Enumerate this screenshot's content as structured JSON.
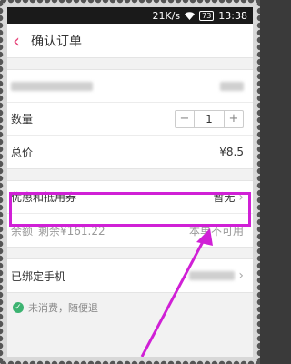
{
  "statusbar": {
    "speed": "21K/s",
    "battery": "73",
    "time": "13:38"
  },
  "header": {
    "back_icon": "chevron-left-icon",
    "title": "确认订单"
  },
  "order": {
    "quantity_label": "数量",
    "quantity_value": "1",
    "minus": "−",
    "plus": "+",
    "total_label": "总价",
    "total_value": "¥8.5"
  },
  "discount": {
    "coupon_label": "优惠和抵用券",
    "coupon_value": "暂无",
    "balance_label": "余额",
    "balance_remaining": "剩余¥161.22",
    "balance_status": "本单不可用"
  },
  "phone": {
    "label": "已绑定手机"
  },
  "note": {
    "text": "未消费，随便退"
  },
  "colors": {
    "accent": "#e6457a",
    "highlight": "#d020d6",
    "check": "#3cb371"
  }
}
